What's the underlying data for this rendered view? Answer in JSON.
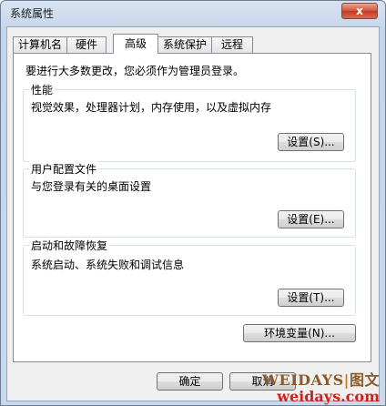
{
  "window": {
    "title": "系统属性",
    "close_label": "x"
  },
  "tabs": [
    {
      "label": "计算机名",
      "active": false
    },
    {
      "label": "硬件",
      "active": false
    },
    {
      "label": "高级",
      "active": true
    },
    {
      "label": "系统保护",
      "active": false
    },
    {
      "label": "远程",
      "active": false
    }
  ],
  "advanced": {
    "notice": "要进行大多数更改，您必须作为管理员登录。",
    "performance": {
      "title": "性能",
      "description": "视觉效果，处理器计划，内存使用，以及虚拟内存",
      "button": "设置(S)..."
    },
    "profiles": {
      "title": "用户配置文件",
      "description": "与您登录有关的桌面设置",
      "button": "设置(E)..."
    },
    "startup": {
      "title": "启动和故障恢复",
      "description": "系统启动、系统失败和调试信息",
      "button": "设置(T)..."
    },
    "env_button": "环境变量(N)..."
  },
  "footer": {
    "ok": "确定",
    "cancel": "取消"
  },
  "watermark": {
    "brand": "WEIDAYS",
    "separator": "|",
    "tag": "图文",
    "url": "weidays.com"
  }
}
